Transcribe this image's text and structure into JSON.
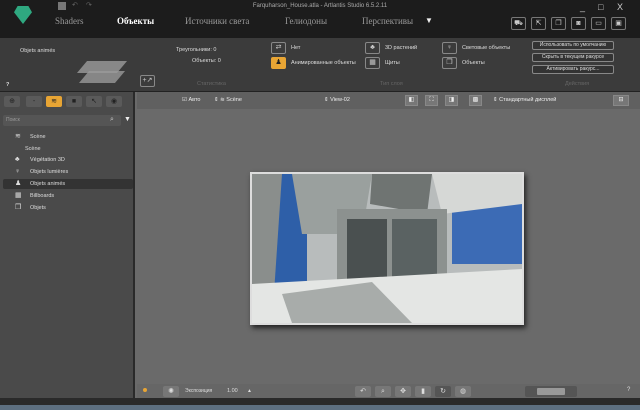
{
  "window": {
    "title": "Farquharson_House.atla - Artlantis Studio 6.5.2.11",
    "minimize": "_",
    "maximize": "□",
    "close": "X"
  },
  "tabs": [
    {
      "label": "Shaders"
    },
    {
      "label": "Объекты",
      "active": true
    },
    {
      "label": "Источники света"
    },
    {
      "label": "Гелиодоны"
    },
    {
      "label": "Перспективы"
    }
  ],
  "ribbon": {
    "panel_title": "Objets animés",
    "help": "?",
    "stats": {
      "triangles": "Треугольники: 0",
      "objects": "Объекты: 0",
      "section": "Статистика"
    },
    "layer_types": {
      "none": "Нет",
      "animated": "Анимированные объекты",
      "veg": "3D растений",
      "shields": "Щиты",
      "lights": "Световые объекты",
      "objects": "Объекты",
      "section": "Тип слоя"
    },
    "actions": {
      "default": "Использовать по умолчанию",
      "hide": "Скрыть в текущем ракурсе",
      "activate": "Активировать ракурс...",
      "section": "Действия"
    }
  },
  "sidebar": {
    "search_placeholder": "Поиск",
    "items": [
      {
        "label": "Scène",
        "icon": "layers-icon"
      },
      {
        "label": "Scène",
        "icon": ""
      },
      {
        "label": "Végétation 3D",
        "icon": "tree-icon"
      },
      {
        "label": "Objets lumières",
        "icon": "lamp-icon"
      },
      {
        "label": "Objets animés",
        "icon": "animated-people-icon",
        "selected": true
      },
      {
        "label": "Billboards",
        "icon": "billboard-icon"
      },
      {
        "label": "Objets",
        "icon": "cube-icon"
      }
    ]
  },
  "viewport": {
    "auto": "Авто",
    "scene": "Scène",
    "view": "View-02",
    "display": "Стандартный дисплей"
  },
  "bottom": {
    "exposure_label": "Экспозиция",
    "exposure_value": "1.00",
    "help": "?"
  },
  "colors": {
    "accent": "#e8a534",
    "selected": "#333333"
  }
}
